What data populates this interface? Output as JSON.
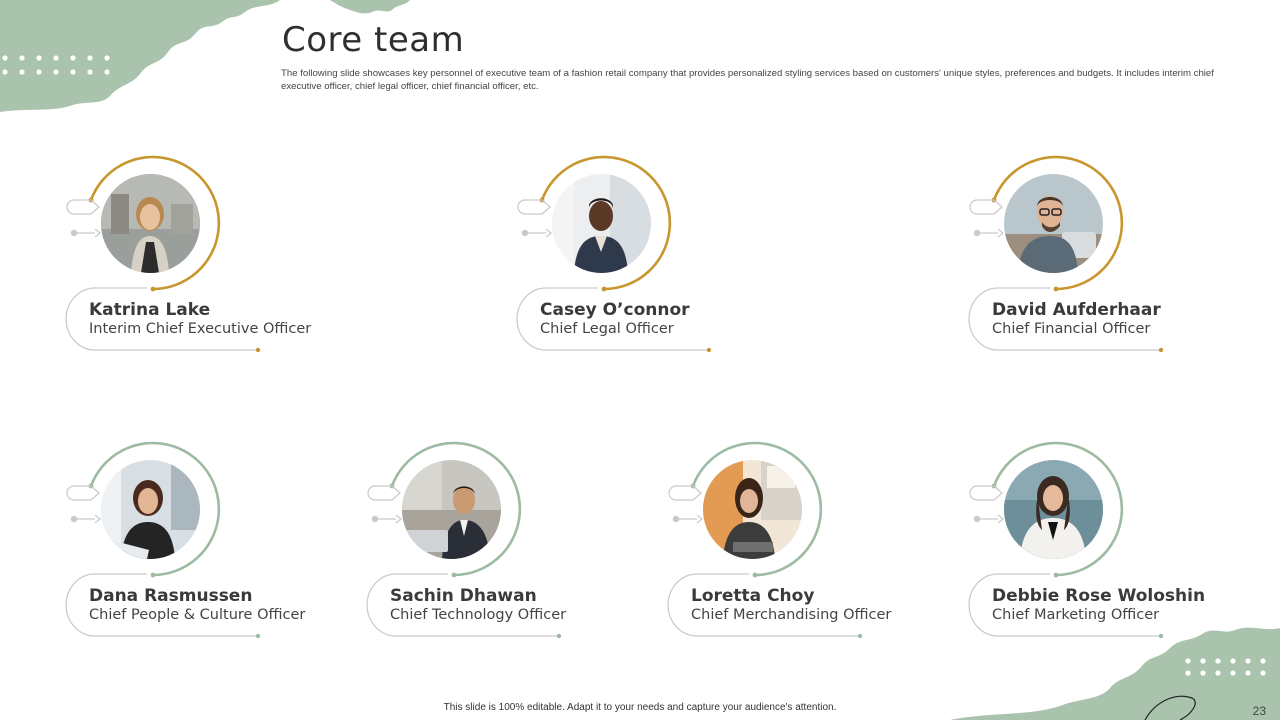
{
  "slide": {
    "title": "Core team",
    "subtitle": "The following slide showcases key personnel of executive team of a  fashion retail company that provides personalized styling services based on customers' unique styles, preferences and budgets. It includes interim  chief executive officer, chief legal officer, chief financial officer, etc.",
    "footer": "This slide is 100% editable.  Adapt it to your needs and capture your audience's attention.",
    "page_number": "23"
  },
  "colors": {
    "gold_accent": "#c8962f",
    "sage_accent": "#9dbba2",
    "sage_blob": "#a9c3ad",
    "gray_line": "#c9c9c9"
  },
  "team": [
    {
      "name": "Katrina Lake",
      "role": "Interim Chief Executive Officer",
      "accent": "gold",
      "icon": "woman-portrait"
    },
    {
      "name": "Casey O’connor",
      "role": "Chief Legal Officer",
      "accent": "gold",
      "icon": "man-portrait"
    },
    {
      "name": "David Aufderhaar",
      "role": "Chief Financial Officer",
      "accent": "gold",
      "icon": "man-glasses-portrait"
    },
    {
      "name": "Dana Rasmussen",
      "role": "Chief People & Culture Officer",
      "accent": "sage",
      "icon": "woman-laptop-portrait"
    },
    {
      "name": "Sachin Dhawan",
      "role": "Chief Technology Officer",
      "accent": "sage",
      "icon": "man-suit-portrait"
    },
    {
      "name": "Loretta Choy",
      "role": "Chief Merchandising  Officer",
      "accent": "sage",
      "icon": "woman-desk-portrait"
    },
    {
      "name": "Debbie Rose Woloshin",
      "role": "Chief Marketing  Officer",
      "accent": "sage",
      "icon": "woman-white-jacket-portrait"
    }
  ]
}
